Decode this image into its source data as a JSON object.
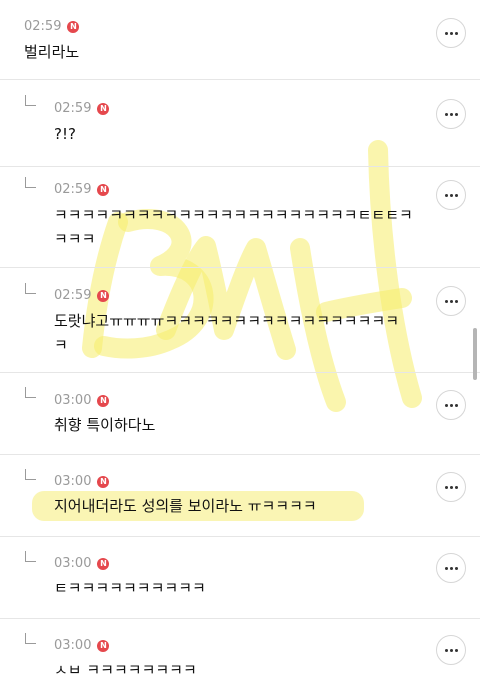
{
  "comments": [
    {
      "time": "02:59",
      "badge": "N",
      "text": "벌리라노"
    },
    {
      "time": "02:59",
      "badge": "N",
      "text": "?!?"
    },
    {
      "time": "02:59",
      "badge": "N",
      "text": "ㅋㅋㅋㅋㅋㅋㅋㅋㅋㅋㅋㅋㅋㅋㅋㅋㅋㅋㅋㅋㅋㅋㅌㅌㅌㅋ",
      "text2": "ㅋㅋㅋ"
    },
    {
      "time": "02:59",
      "badge": "N",
      "text": "도랏냐고ㅠㅠㅠㅠㅋㅋㅋㅋㅋㅋㅋㅋㅋㅋㅋㅋㅋㅋㅋㅋㅋ",
      "text2": "ㅋ"
    },
    {
      "time": "03:00",
      "badge": "N",
      "text": "취향 특이하다노"
    },
    {
      "time": "03:00",
      "badge": "N",
      "text": "지어내더라도 성의를 보이라노 ㅠㅋㅋㅋㅋ"
    },
    {
      "time": "03:00",
      "badge": "N",
      "text": "ㅌㅋㅋㅋㅋㅋㅋㅋㅋㅋㅋ"
    },
    {
      "time": "03:00",
      "badge": "N",
      "text": "ㅅㅂ ㅋㅋㅋㅋㅋㅋㅋㅋ"
    }
  ],
  "colors": {
    "badge": "#e5484d",
    "highlight": "#f5ec6a",
    "divider": "#e6e6e6",
    "time": "#9a9a9a"
  },
  "icons": {
    "more": "more-dots-icon",
    "reply": "reply-arrow-icon",
    "new": "new-badge-icon"
  }
}
